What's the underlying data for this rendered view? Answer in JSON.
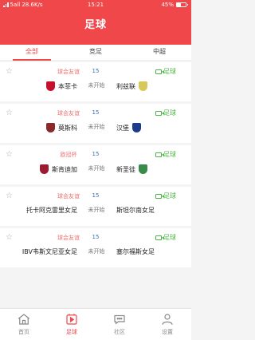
{
  "status": {
    "carrier": "5all 28.6K/s",
    "time": "15:21",
    "battery": "45%",
    "battery_level": 0.45
  },
  "header": {
    "title": "足球"
  },
  "tabs": [
    {
      "label": "全部",
      "active": true
    },
    {
      "label": "竞足",
      "active": false
    },
    {
      "label": "中超",
      "active": false
    }
  ],
  "matches": [
    {
      "league": "球会友谊",
      "round": "15",
      "home": "本菲卡",
      "away": "利兹联",
      "state": "未开始",
      "live": "足球",
      "home_color": "#c8102e",
      "away_color": "#d8c85a"
    },
    {
      "league": "球会友谊",
      "round": "15",
      "home": "莫斯科",
      "away": "汉堡",
      "state": "未开始",
      "live": "足球",
      "home_color": "#8a2a2a",
      "away_color": "#1d3b8a"
    },
    {
      "league": "欧冠杯",
      "round": "15",
      "home": "斯肯迪加",
      "away": "新圣徒",
      "state": "未开始",
      "live": "足球",
      "home_color": "#9b1b30",
      "away_color": "#3a8a4a"
    },
    {
      "league": "球会友谊",
      "round": "15",
      "home": "托卡阿克雷里女足",
      "away": "斯坦尔南女足",
      "state": "未开始",
      "live": "足球"
    },
    {
      "league": "球会友谊",
      "round": "15",
      "home": "IBV韦斯文尼亚女足",
      "away": "塞尔福斯女足",
      "state": "未开始",
      "live": "足球"
    }
  ],
  "nav": [
    {
      "label": "首页",
      "icon": "home-icon",
      "active": false
    },
    {
      "label": "足球",
      "icon": "play-icon",
      "active": true
    },
    {
      "label": "社区",
      "icon": "chat-icon",
      "active": false
    },
    {
      "label": "设置",
      "icon": "user-icon",
      "active": false
    }
  ],
  "colors": {
    "accent": "#f0474b",
    "live": "#4bb543",
    "league": "#f07070",
    "round": "#3a6fb0"
  }
}
